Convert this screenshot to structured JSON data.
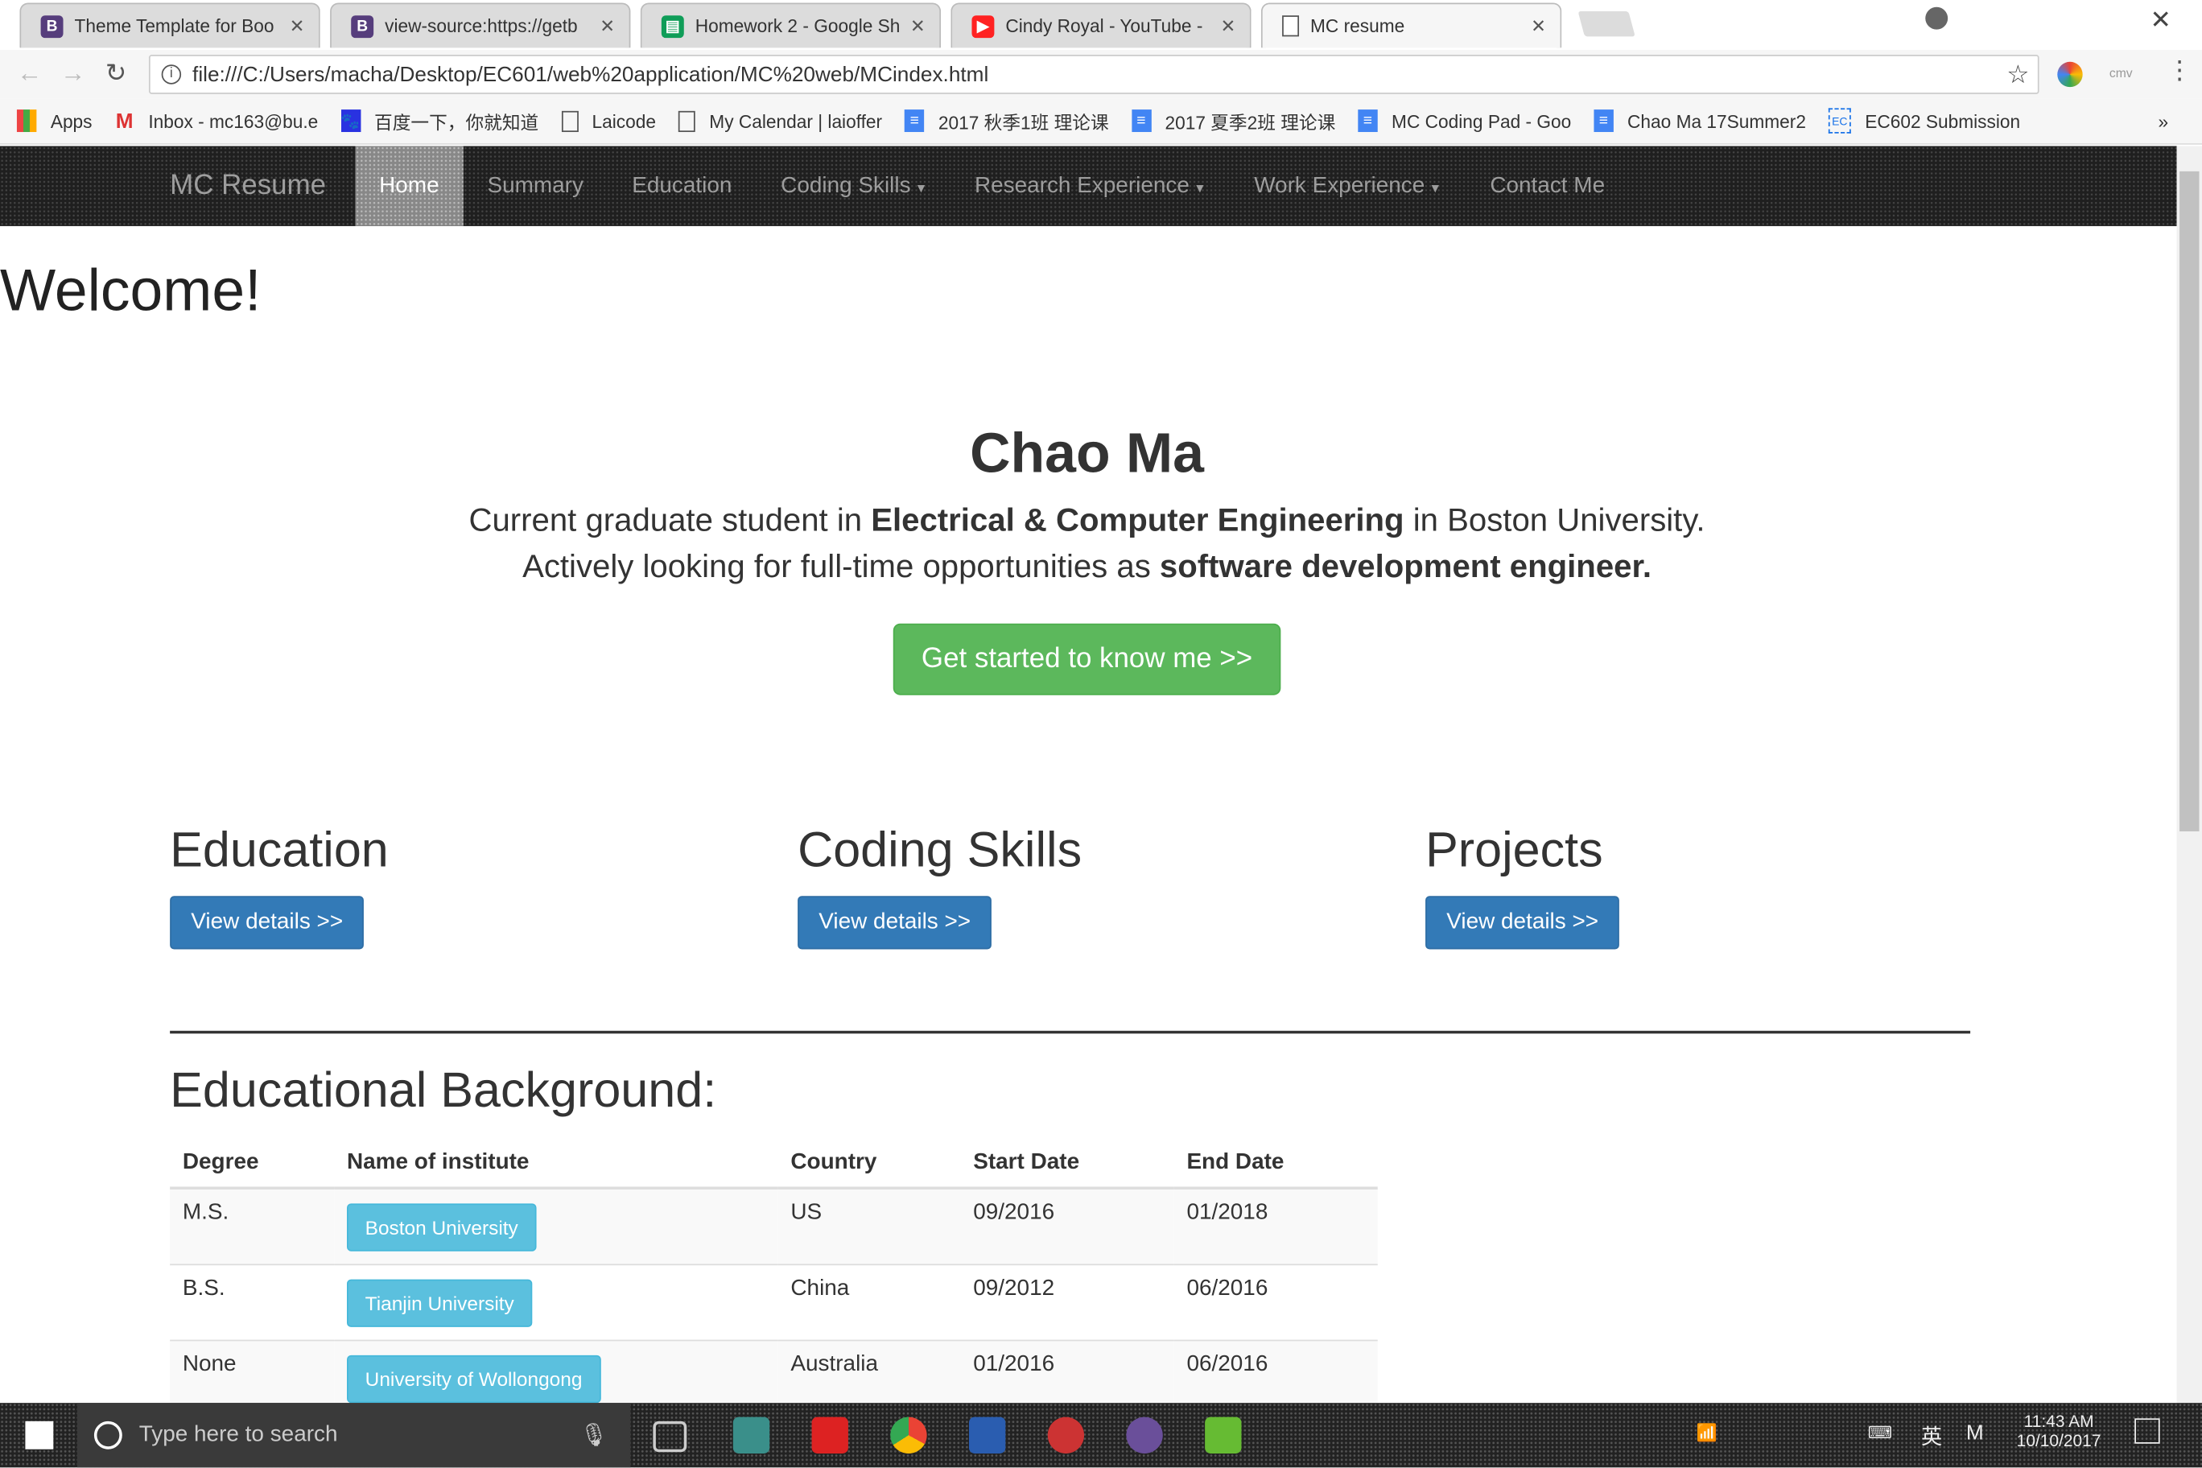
{
  "browser": {
    "tabs": [
      {
        "title": "Theme Template for Boo",
        "icon": "bootstrap-icon",
        "color": "#563d7c"
      },
      {
        "title": "view-source:https://getb",
        "icon": "bootstrap-icon",
        "color": "#563d7c"
      },
      {
        "title": "Homework 2 - Google Sh",
        "icon": "sheets-icon",
        "color": "#0f9d58"
      },
      {
        "title": "Cindy Royal - YouTube -",
        "icon": "youtube-icon",
        "color": "#ff0000"
      },
      {
        "title": "MC resume",
        "icon": "page-icon",
        "color": "#666666",
        "active": true
      }
    ],
    "url": "file:///C:/Users/macha/Desktop/EC601/web%20application/MC%20web/MCindex.html",
    "bookmarks": [
      {
        "label": "Apps",
        "icon": "apps-grid-icon"
      },
      {
        "label": "Inbox - mc163@bu.e",
        "icon": "gmail-icon"
      },
      {
        "label": "百度一下，你就知道",
        "icon": "baidu-icon"
      },
      {
        "label": "Laicode",
        "icon": "page-icon"
      },
      {
        "label": "My Calendar | laioffer",
        "icon": "page-icon"
      },
      {
        "label": "2017 秋季1班 理论课",
        "icon": "docs-icon"
      },
      {
        "label": "2017 夏季2班 理论课",
        "icon": "docs-icon"
      },
      {
        "label": "MC Coding Pad - Goo",
        "icon": "docs-icon"
      },
      {
        "label": "Chao Ma 17Summer2",
        "icon": "docs-icon"
      },
      {
        "label": "EC602 Submission",
        "icon": "ec602-icon"
      }
    ],
    "more_bookmarks": "»"
  },
  "navbar": {
    "brand": "MC Resume",
    "items": [
      "Home",
      "Summary",
      "Education",
      "Coding Skills",
      "Research Experience",
      "Work Experience",
      "Contact Me"
    ],
    "active": "Home"
  },
  "page": {
    "welcome": "Welcome!",
    "name": "Chao Ma",
    "line1_pre": "Current graduate student in ",
    "line1_bold": "Electrical & Computer Engineering",
    "line1_post": " in Boston University.",
    "line2_pre": "Actively looking for full-time opportunities as ",
    "line2_bold": "software development engineer.",
    "cta": "Get started to know me >>",
    "sections": [
      {
        "title": "Education",
        "button": "View details >>"
      },
      {
        "title": "Coding Skills",
        "button": "View details >>"
      },
      {
        "title": "Projects",
        "button": "View details >>"
      }
    ],
    "edu_title": "Educational Background:",
    "table": {
      "headers": [
        "Degree",
        "Name of institute",
        "Country",
        "Start Date",
        "End Date"
      ],
      "rows": [
        [
          "M.S.",
          "Boston University",
          "US",
          "09/2016",
          "01/2018"
        ],
        [
          "B.S.",
          "Tianjin University",
          "China",
          "09/2012",
          "06/2016"
        ],
        [
          "None",
          "University of Wollongong",
          "Australia",
          "01/2016",
          "06/2016"
        ]
      ]
    }
  },
  "taskbar": {
    "search_placeholder": "Type here to search",
    "time": "11:43 AM",
    "date": "10/10/2017",
    "ime": "英"
  }
}
